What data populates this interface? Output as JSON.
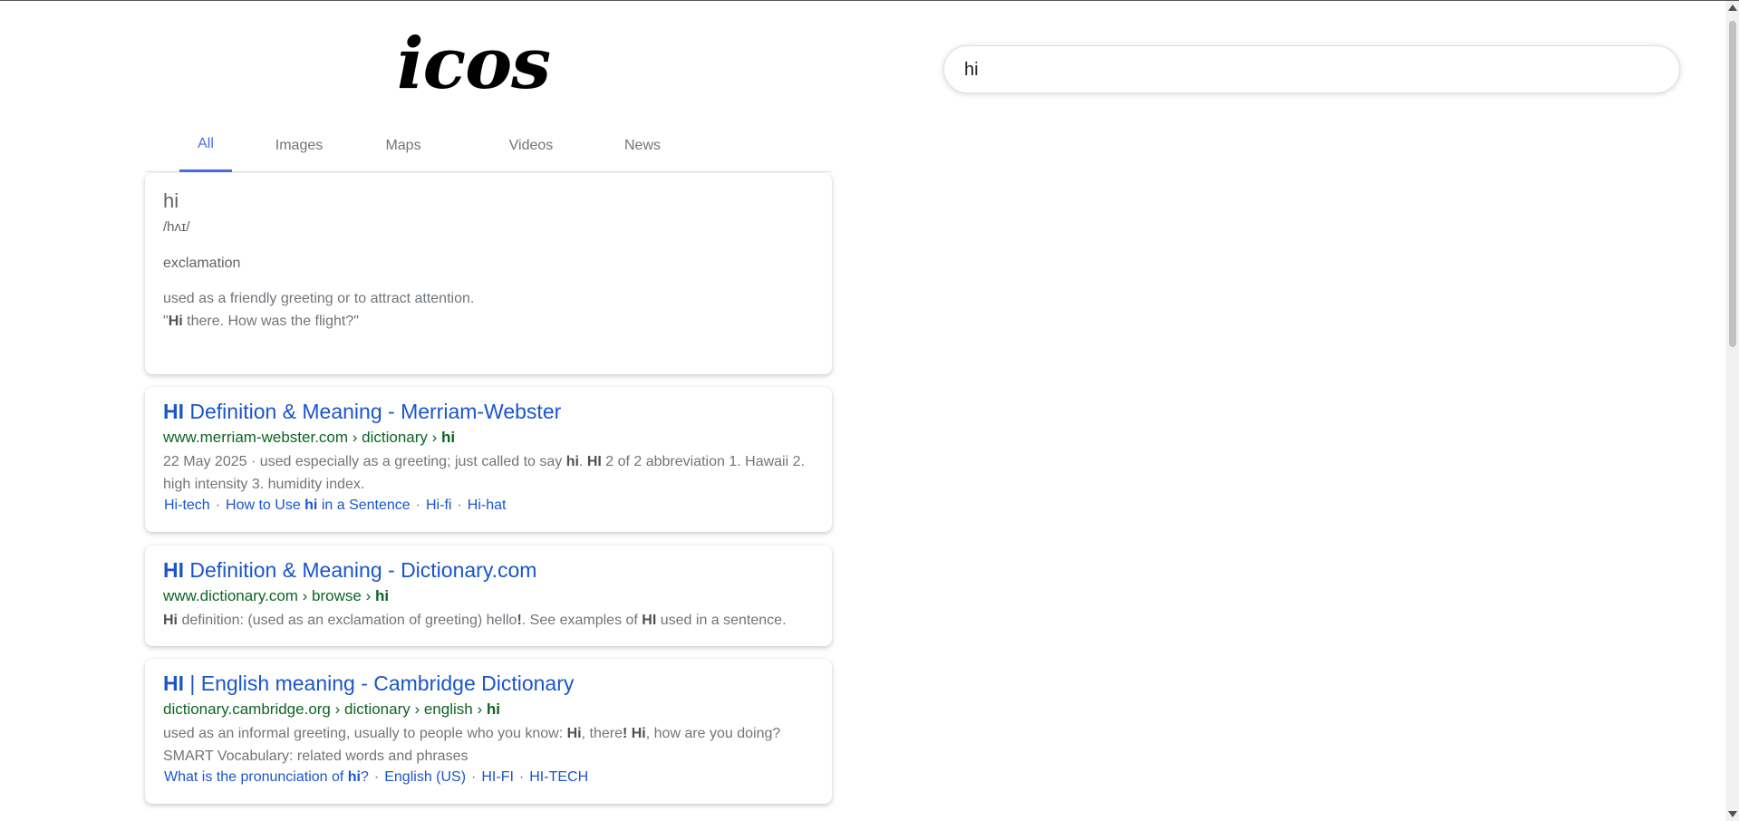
{
  "logo": {
    "text": "icos"
  },
  "search": {
    "value": "hi"
  },
  "tabs": [
    {
      "label": "All",
      "active": true
    },
    {
      "label": "Images",
      "active": false
    },
    {
      "label": "Maps",
      "active": false
    },
    {
      "label": "Videos",
      "active": false
    },
    {
      "label": "News",
      "active": false
    }
  ],
  "dictionary": {
    "word": "hi",
    "phonetic": "/hʌɪ/",
    "part_of_speech": "exclamation",
    "definition": "used as a friendly greeting or to attract attention.",
    "example_prefix": "\"",
    "example_bold": "Hi",
    "example_rest": " there. How was the flight?\""
  },
  "results": [
    {
      "title_bold": "HI",
      "title_rest": " Definition & Meaning - Merriam-Webster",
      "url_plain": "www.merriam-webster.com › dictionary › ",
      "url_bold": "hi",
      "snippet_parts": [
        {
          "text": "22 May 2025 · used especially as a greeting; just called to say ",
          "bold": false
        },
        {
          "text": "hi",
          "bold": true
        },
        {
          "text": ". ",
          "bold": false
        },
        {
          "text": "HI",
          "bold": true
        },
        {
          "text": " 2 of 2 abbreviation 1. Hawaii 2. high intensity 3. humidity index.",
          "bold": false
        }
      ],
      "sitelinks": [
        {
          "parts": [
            {
              "text": "Hi-tech",
              "bold": false
            }
          ]
        },
        {
          "parts": [
            {
              "text": "How to Use ",
              "bold": false
            },
            {
              "text": "hi",
              "bold": true
            },
            {
              "text": " in a Sentence",
              "bold": false
            }
          ]
        },
        {
          "parts": [
            {
              "text": "Hi-fi",
              "bold": false
            }
          ]
        },
        {
          "parts": [
            {
              "text": "Hi-hat",
              "bold": false
            }
          ]
        }
      ]
    },
    {
      "title_bold": "HI",
      "title_rest": " Definition & Meaning - Dictionary.com",
      "url_plain": "www.dictionary.com › browse › ",
      "url_bold": "hi",
      "snippet_parts": [
        {
          "text": "Hi",
          "bold": true
        },
        {
          "text": " definition: (used as an exclamation of greeting) hello",
          "bold": false
        },
        {
          "text": "!",
          "bold": true
        },
        {
          "text": ". See examples of ",
          "bold": false
        },
        {
          "text": "HI",
          "bold": true
        },
        {
          "text": " used in a sentence.",
          "bold": false
        }
      ],
      "sitelinks": []
    },
    {
      "title_bold": "HI",
      "title_rest": " | English meaning - Cambridge Dictionary",
      "url_plain": "dictionary.cambridge.org › dictionary › english › ",
      "url_bold": "hi",
      "snippet_parts": [
        {
          "text": "used as an informal greeting, usually to people who you know: ",
          "bold": false
        },
        {
          "text": "Hi",
          "bold": true
        },
        {
          "text": ", there",
          "bold": false
        },
        {
          "text": "!",
          "bold": true
        },
        {
          "text": " ",
          "bold": false
        },
        {
          "text": "Hi",
          "bold": true
        },
        {
          "text": ", how are you doing? SMART Vocabulary: related words and phrases",
          "bold": false
        }
      ],
      "sitelinks": [
        {
          "parts": [
            {
              "text": "What is the pronunciation of ",
              "bold": false
            },
            {
              "text": "hi",
              "bold": true
            },
            {
              "text": "?",
              "bold": false
            }
          ]
        },
        {
          "parts": [
            {
              "text": "English (US)",
              "bold": false
            }
          ]
        },
        {
          "parts": [
            {
              "text": "HI-FI",
              "bold": false
            }
          ]
        },
        {
          "parts": [
            {
              "text": "HI-TECH",
              "bold": false
            }
          ]
        }
      ]
    }
  ]
}
